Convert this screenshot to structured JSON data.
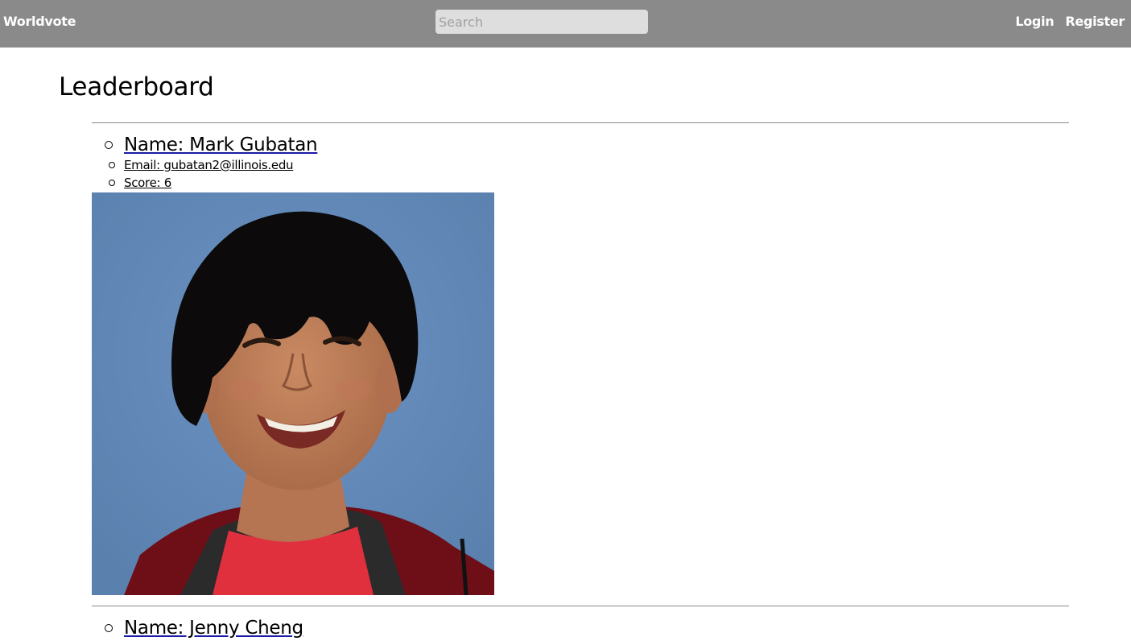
{
  "navbar": {
    "brand": "Worldvote",
    "search_placeholder": "Search",
    "login_label": "Login",
    "register_label": "Register",
    "background_color": "#8a8a8a"
  },
  "page": {
    "title": "Leaderboard"
  },
  "entries": [
    {
      "name": "Name: Mark Gubatan",
      "email": "Email: gubatan2@illinois.edu",
      "score": "Score: 6"
    },
    {
      "name": "Name: Jenny Cheng"
    }
  ]
}
